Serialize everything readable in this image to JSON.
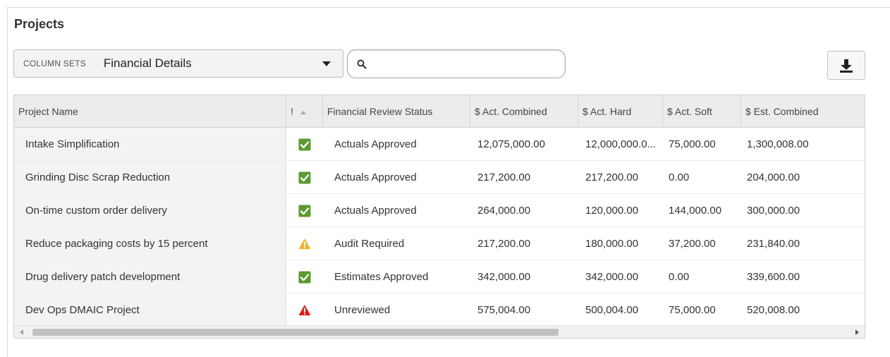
{
  "page": {
    "title": "Projects"
  },
  "column_sets": {
    "label": "COLUMN SETS",
    "selected": "Financial Details"
  },
  "search": {
    "placeholder": "",
    "value": ""
  },
  "icons": {
    "search": "search-icon",
    "download": "download-icon",
    "approved": "check-square-icon",
    "warning": "warning-triangle-icon",
    "alert": "alert-triangle-icon"
  },
  "colors": {
    "approved": "#5b9a32",
    "warning": "#f0b429",
    "alert": "#e01b1b"
  },
  "table": {
    "headers": {
      "name": "Project Name",
      "flag": "!",
      "status": "Financial Review Status",
      "act_combined": "$ Act. Combined",
      "act_hard": "$ Act. Hard",
      "act_soft": "$ Act. Soft",
      "est_combined": "$ Est. Combined"
    },
    "rows": [
      {
        "name": "Intake Simplification",
        "flag": "approved",
        "status": "Actuals Approved",
        "act_combined": "12,075,000.00",
        "act_hard": "12,000,000.0...",
        "act_soft": "75,000.00",
        "est_combined": "1,300,008.00"
      },
      {
        "name": "Grinding Disc Scrap Reduction",
        "flag": "approved",
        "status": "Actuals Approved",
        "act_combined": "217,200.00",
        "act_hard": "217,200.00",
        "act_soft": "0.00",
        "est_combined": "204,000.00"
      },
      {
        "name": "On-time custom order delivery",
        "flag": "approved",
        "status": "Actuals Approved",
        "act_combined": "264,000.00",
        "act_hard": "120,000.00",
        "act_soft": "144,000.00",
        "est_combined": "300,000.00"
      },
      {
        "name": "Reduce packaging costs by 15 percent",
        "flag": "warning",
        "status": "Audit Required",
        "act_combined": "217,200.00",
        "act_hard": "180,000.00",
        "act_soft": "37,200.00",
        "est_combined": "231,840.00"
      },
      {
        "name": "Drug delivery patch development",
        "flag": "approved",
        "status": "Estimates Approved",
        "act_combined": "342,000.00",
        "act_hard": "342,000.00",
        "act_soft": "0.00",
        "est_combined": "339,600.00"
      },
      {
        "name": "Dev Ops DMAIC Project",
        "flag": "alert",
        "status": "Unreviewed",
        "act_combined": "575,004.00",
        "act_hard": "500,004.00",
        "act_soft": "75,000.00",
        "est_combined": "520,008.00"
      }
    ]
  }
}
